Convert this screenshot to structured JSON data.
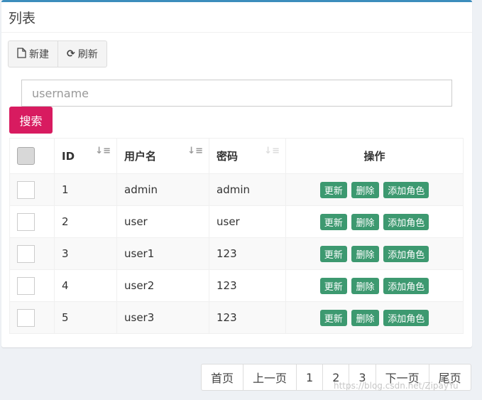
{
  "panel": {
    "title": "列表"
  },
  "toolbar": {
    "new_label": "新建",
    "refresh_label": "刷新"
  },
  "search": {
    "placeholder": "username",
    "button_label": "搜索"
  },
  "table": {
    "columns": [
      "ID",
      "用户名",
      "密码",
      "操作"
    ],
    "rows": [
      {
        "id": "1",
        "username": "admin",
        "password": "admin"
      },
      {
        "id": "2",
        "username": "user",
        "password": "user"
      },
      {
        "id": "3",
        "username": "user1",
        "password": "123"
      },
      {
        "id": "4",
        "username": "user2",
        "password": "123"
      },
      {
        "id": "5",
        "username": "user3",
        "password": "123"
      }
    ],
    "actions": {
      "update": "更新",
      "delete": "删除",
      "add_role": "添加角色"
    }
  },
  "pagination": {
    "first": "首页",
    "prev": "上一页",
    "pages": [
      "1",
      "2",
      "3"
    ],
    "next": "下一页",
    "last": "尾页"
  },
  "watermark": "https://blog.csdn.net/ZipayYu",
  "colors": {
    "accent": "#3c8dbc",
    "search_button": "#d81b60",
    "action_button": "#3d9970"
  }
}
